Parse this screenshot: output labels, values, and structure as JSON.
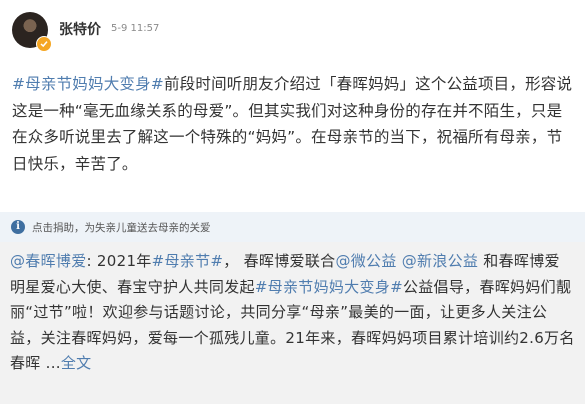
{
  "header": {
    "author_name": "张特价",
    "timestamp": "5-9 11:57",
    "avatar_icon": "user-avatar",
    "verified_icon": "verified-badge-icon"
  },
  "post": {
    "topic_tag": "#母亲节妈妈大变身#",
    "body_line1": "前段时间听朋友介绍过「春晖妈妈」这个公益项目，形容说这是一种“毫无血缘关系的母爱”。但其实我们对这种身份的存在并不陌生，只是在众多听说里去了解这一个特殊的“妈妈”。在母亲节的当下，祝福所有母亲，节日快乐，辛苦了。"
  },
  "notice": {
    "icon": "info-icon",
    "icon_glyph": "i",
    "text": "点击捐助，为失亲儿童送去母亲的关爱"
  },
  "repost": {
    "author_mention": "@春晖博爱",
    "text_1": ": 2021年",
    "tag_1": "#母亲节#",
    "text_2": "， 春晖博爱联合",
    "mention_1": "@微公益",
    "text_3": " ",
    "mention_2": "@新浪公益",
    "text_4": " 和春晖博爱明星爱心大使、春宝守护人共同发起",
    "tag_2": "#母亲节妈妈大变身#",
    "text_5": "公益倡导，春晖妈妈们靓丽“过节”啦！欢迎参与话题讨论，共同分享“母亲”最美的一面，让更多人关注公益，关注春晖妈妈，爱每一个孤残儿童。21年来，春晖妈妈项目累计培训约2.6万名春晖 ...",
    "expand_link": "全文"
  },
  "colors": {
    "link": "#507daf",
    "text": "#333333",
    "time": "#8a8a8a",
    "notice_bg": "#eef3f8",
    "repost_bg": "#f2f2f2",
    "verified": "#f5a623"
  }
}
